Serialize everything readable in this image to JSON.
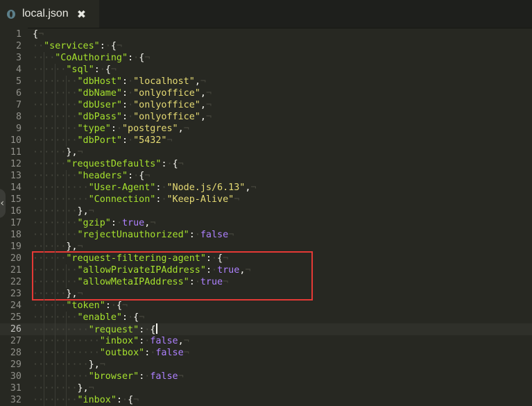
{
  "tab": {
    "title": "local.json",
    "close": "✖",
    "file_icon": "json-file-icon"
  },
  "side_handle": {
    "glyph": "‹"
  },
  "current_line": 26,
  "lines": [
    {
      "n": "1",
      "code": "{¬"
    },
    {
      "n": "2",
      "code": "··\"services\":·{¬"
    },
    {
      "n": "3",
      "code": "····\"CoAuthoring\":·{¬"
    },
    {
      "n": "4",
      "code": "······\"sql\":·{¬"
    },
    {
      "n": "5",
      "code": "········\"dbHost\":·\"localhost\",¬"
    },
    {
      "n": "6",
      "code": "········\"dbName\":·\"onlyoffice\",¬"
    },
    {
      "n": "7",
      "code": "········\"dbUser\":·\"onlyoffice\",¬"
    },
    {
      "n": "8",
      "code": "········\"dbPass\":·\"onlyoffice\",¬"
    },
    {
      "n": "9",
      "code": "········\"type\":·\"postgres\",¬"
    },
    {
      "n": "10",
      "code": "········\"dbPort\":·\"5432\"¬"
    },
    {
      "n": "11",
      "code": "······},¬"
    },
    {
      "n": "12",
      "code": "······\"requestDefaults\":·{¬"
    },
    {
      "n": "13",
      "code": "········\"headers\":·{¬"
    },
    {
      "n": "14",
      "code": "··········\"User-Agent\":·\"Node.js/6.13\",¬"
    },
    {
      "n": "15",
      "code": "··········\"Connection\":·\"Keep-Alive\"¬"
    },
    {
      "n": "16",
      "code": "········},¬"
    },
    {
      "n": "17",
      "code": "········\"gzip\":·true,¬"
    },
    {
      "n": "18",
      "code": "········\"rejectUnauthorized\":·false¬"
    },
    {
      "n": "19",
      "code": "······},¬"
    },
    {
      "n": "20",
      "code": "······\"request-filtering-agent\":·{¬"
    },
    {
      "n": "21",
      "code": "········\"allowPrivateIPAddress\":·true,¬"
    },
    {
      "n": "22",
      "code": "········\"allowMetaIPAddress\":·true¬"
    },
    {
      "n": "23",
      "code": "······},¬"
    },
    {
      "n": "24",
      "code": "······\"token\":·{¬"
    },
    {
      "n": "25",
      "code": "········\"enable\":·{¬"
    },
    {
      "n": "26",
      "code": "··········\"request\":·{|"
    },
    {
      "n": "27",
      "code": "············\"inbox\":·false,¬"
    },
    {
      "n": "28",
      "code": "············\"outbox\":·false¬"
    },
    {
      "n": "29",
      "code": "··········},¬"
    },
    {
      "n": "30",
      "code": "··········\"browser\":·false¬"
    },
    {
      "n": "31",
      "code": "········},¬"
    },
    {
      "n": "32",
      "code": "········\"inbox\":·{¬"
    }
  ],
  "colors": {
    "background": "#272822",
    "key": "#a6e22e",
    "string": "#e6db74",
    "keyword": "#ae81ff",
    "highlight_box": "#e53935"
  }
}
